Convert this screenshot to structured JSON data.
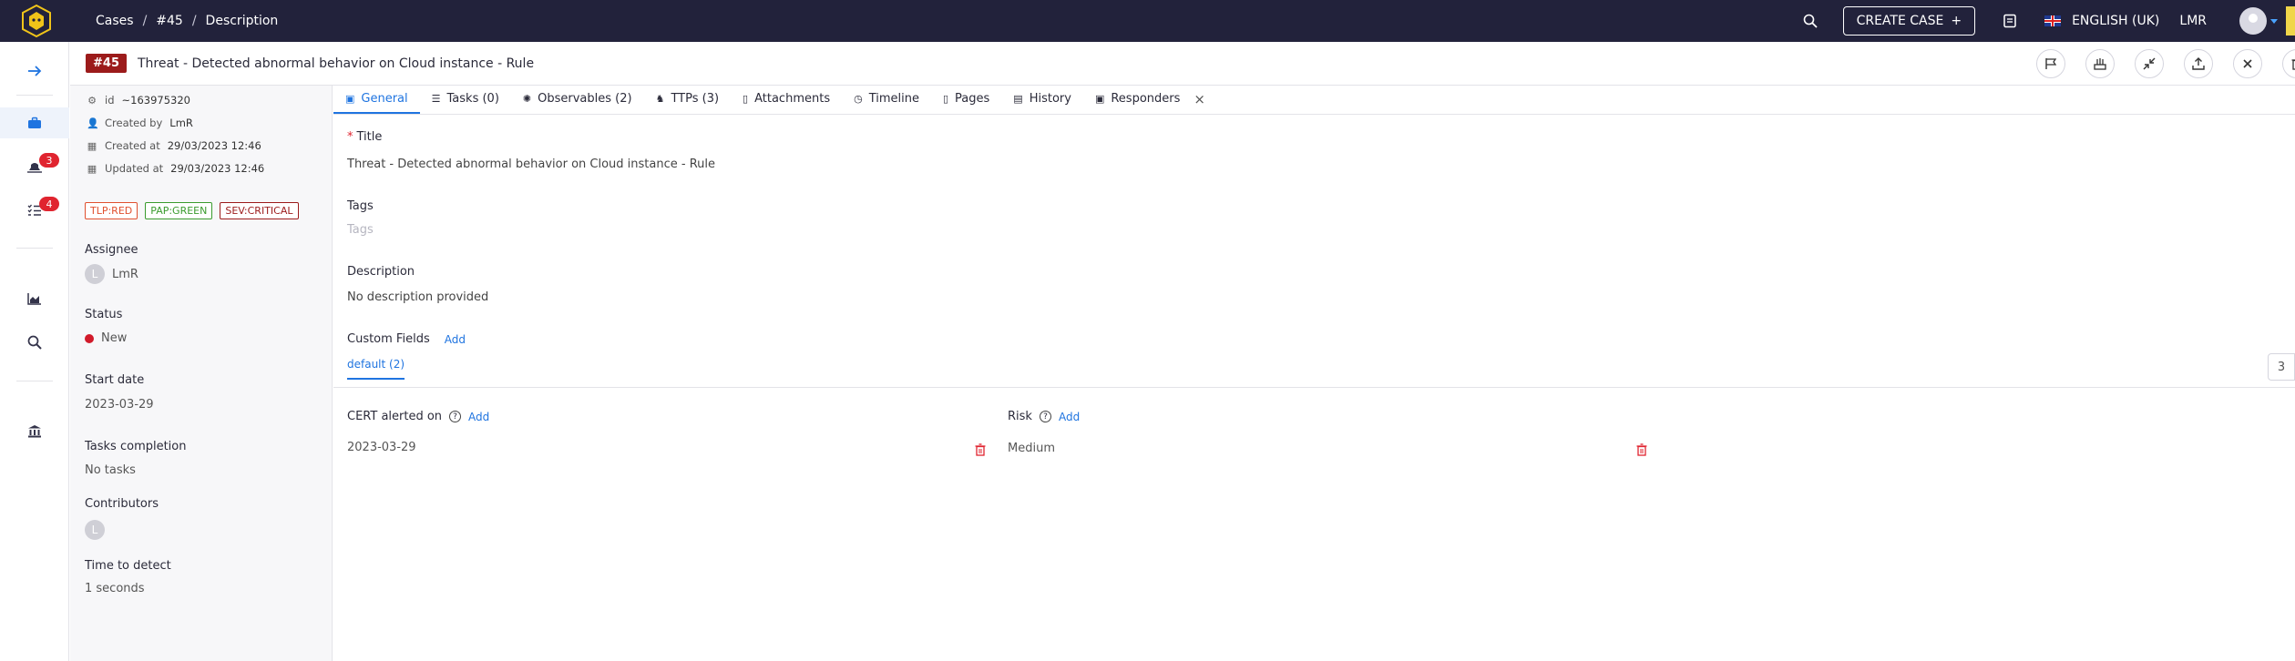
{
  "breadcrumb": {
    "cases": "Cases",
    "case_ref": "#45",
    "current": "Description",
    "sep": "/"
  },
  "topbar": {
    "create_case_label": "CREATE CASE",
    "create_case_plus": "+",
    "language": "ENGLISH (UK)",
    "user_initials": "LMR"
  },
  "nav": {
    "badges": {
      "alerts": "3",
      "tasks": "4"
    }
  },
  "case": {
    "number": "#45",
    "title": "Threat - Detected abnormal behavior on Cloud instance - Rule"
  },
  "details": {
    "id_label": "id",
    "id_value": "~163975320",
    "created_by_label": "Created by",
    "created_by_value": "LmR",
    "created_at_label": "Created at",
    "created_at_value": "29/03/2023 12:46",
    "updated_at_label": "Updated at",
    "updated_at_value": "29/03/2023 12:46",
    "tags": {
      "tlp": "TLP:RED",
      "pap": "PAP:GREEN",
      "sev": "SEV:CRITICAL"
    },
    "assignee_label": "Assignee",
    "assignee_initial": "L",
    "assignee_value": "LmR",
    "status_label": "Status",
    "status_value": "New",
    "start_date_label": "Start date",
    "start_date_value": "2023-03-29",
    "tasks_label": "Tasks completion",
    "tasks_value": "No tasks",
    "contributors_label": "Contributors",
    "contributor_initial": "L",
    "ttd_label": "Time to detect",
    "ttd_value": "1 seconds"
  },
  "tabs": [
    {
      "label": "General"
    },
    {
      "label": "Tasks (0)"
    },
    {
      "label": "Observables (2)"
    },
    {
      "label": "TTPs (3)"
    },
    {
      "label": "Attachments"
    },
    {
      "label": "Timeline"
    },
    {
      "label": "Pages"
    },
    {
      "label": "History"
    },
    {
      "label": "Responders"
    }
  ],
  "tab_close": "×",
  "general": {
    "title_required": "*",
    "title_label": "Title",
    "title_value": "Threat - Detected abnormal behavior on Cloud instance - Rule",
    "tags_label": "Tags",
    "tags_placeholder": "Tags",
    "description_label": "Description",
    "description_value": "No description provided",
    "custom_fields_label": "Custom Fields",
    "custom_fields_add": "Add",
    "cf_tab": "default (2)",
    "pager_value": "3",
    "fields": [
      {
        "name": "CERT alerted on",
        "add": "Add",
        "value": "2023-03-29"
      },
      {
        "name": "Risk",
        "add": "Add",
        "value": "Medium"
      }
    ]
  },
  "colors": {
    "topbar": "#22223b",
    "accent": "#1f74e0",
    "danger": "#e0242f",
    "case_badge": "#9c1b1b"
  }
}
